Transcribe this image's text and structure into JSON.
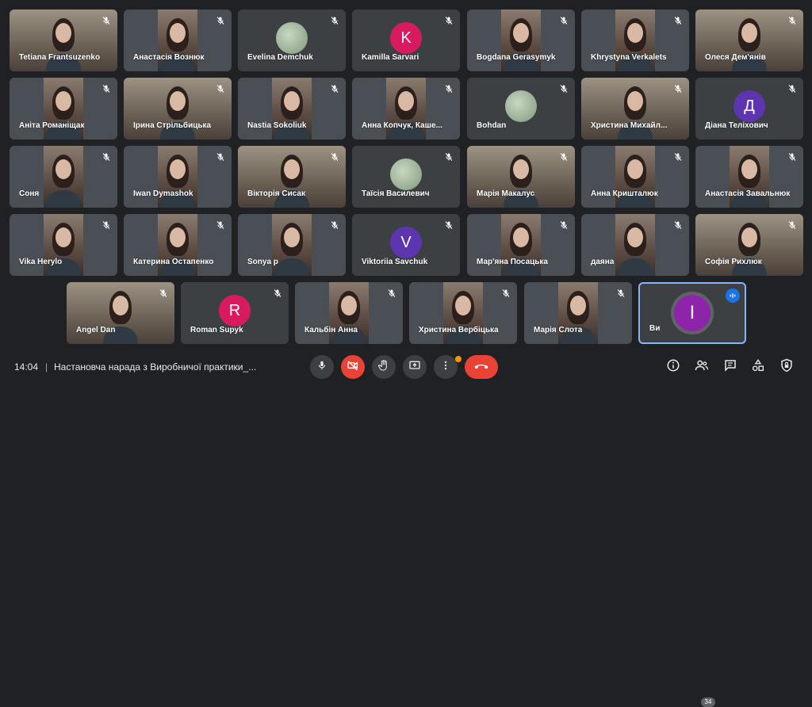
{
  "participants": [
    {
      "name": "Tetiana Frantsuzenko",
      "type": "video",
      "wide": true
    },
    {
      "name": "Анастасія Вознюк",
      "type": "video"
    },
    {
      "name": "Evelina Demchuk",
      "type": "image-avatar"
    },
    {
      "name": "Kamilla Sarvari",
      "type": "letter",
      "letter": "K",
      "color": "#d81b60"
    },
    {
      "name": "Bogdana Gerasymyk",
      "type": "video"
    },
    {
      "name": "Khrystyna Verkalets",
      "type": "video"
    },
    {
      "name": "Олеся Дем'янів",
      "type": "video",
      "wide": true
    },
    {
      "name": "Аніта Романіщак",
      "type": "video"
    },
    {
      "name": "Ірина Стрільбицька",
      "type": "video",
      "wide": true
    },
    {
      "name": "Nastia Sokoliuk",
      "type": "video"
    },
    {
      "name": "Анна Копчук, Каше...",
      "type": "video"
    },
    {
      "name": "Bohdan",
      "type": "image-avatar"
    },
    {
      "name": "Христина Михайл...",
      "type": "video",
      "wide": true
    },
    {
      "name": "Діана Теліхович",
      "type": "letter",
      "letter": "Д",
      "color": "#5e35b1"
    },
    {
      "name": "Соня",
      "type": "video"
    },
    {
      "name": "Iwan Dymashok",
      "type": "video"
    },
    {
      "name": "Вікторія Сисак",
      "type": "video",
      "wide": true
    },
    {
      "name": "Таїсія Василевич",
      "type": "image-avatar"
    },
    {
      "name": "Марія Макалус",
      "type": "video",
      "wide": true
    },
    {
      "name": "Анна Кришталюк",
      "type": "video"
    },
    {
      "name": "Анастасія Завальнюк",
      "type": "video"
    },
    {
      "name": "Vika Herylo",
      "type": "video"
    },
    {
      "name": "Катерина Остапенко",
      "type": "video"
    },
    {
      "name": "Sonya p",
      "type": "video"
    },
    {
      "name": "Viktoriia Savchuk",
      "type": "letter",
      "letter": "V",
      "color": "#5e35b1"
    },
    {
      "name": "Мар'яна Посацька",
      "type": "video"
    },
    {
      "name": "даяна",
      "type": "video"
    },
    {
      "name": "Софія Рихлюк",
      "type": "video",
      "wide": true
    },
    {
      "name": "Angel Dan",
      "type": "video",
      "wide": true
    },
    {
      "name": "Roman Supyk",
      "type": "letter",
      "letter": "R",
      "color": "#d81b60"
    },
    {
      "name": "Кальбін Анна",
      "type": "video"
    },
    {
      "name": "Христина Вербіцька",
      "type": "video"
    },
    {
      "name": "Марія Слота",
      "type": "video"
    },
    {
      "name": "Ви",
      "type": "self",
      "letter": "I",
      "color": "#8e24aa"
    }
  ],
  "bottom_bar": {
    "time": "14:04",
    "separator": "|",
    "meeting_title": "Настановча нарада з Виробничої практики_...",
    "controls": [
      "mic-icon",
      "camera-off-icon",
      "raise-hand-icon",
      "present-icon",
      "more-icon",
      "end-call-icon"
    ],
    "right": [
      "info-icon",
      "people-icon",
      "chat-icon",
      "activities-icon",
      "host-controls-icon"
    ],
    "participant_count": "34"
  },
  "colors": {
    "background": "#202124",
    "tile": "#3c4043",
    "end_call": "#ea4335",
    "accent": "#1a73e8",
    "notification": "#f29900"
  }
}
